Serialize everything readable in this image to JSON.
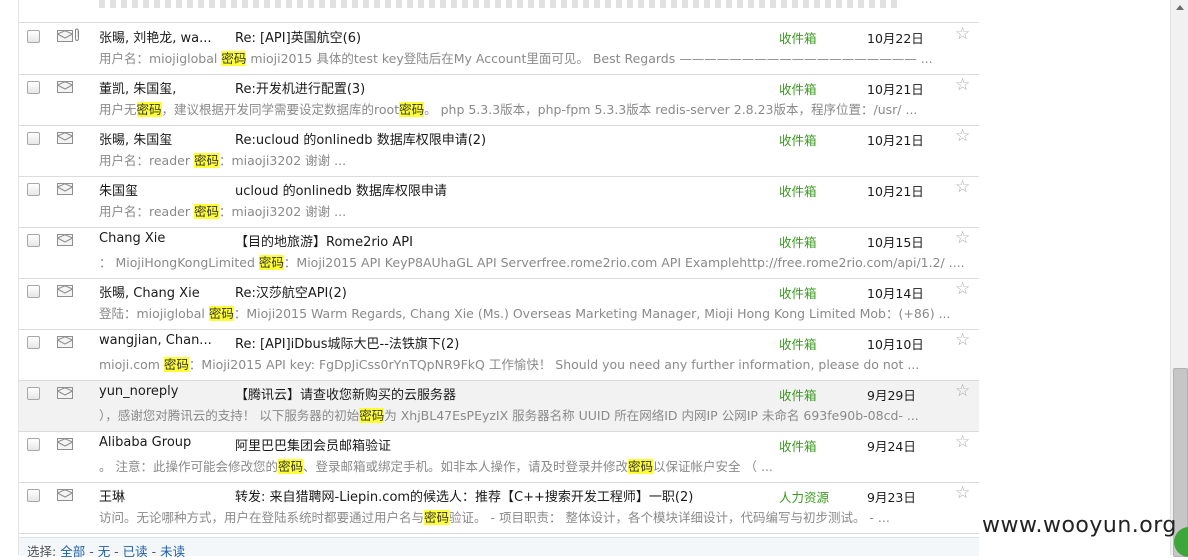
{
  "mail_list": {
    "rows": [
      {
        "from": "张暘, 刘艳龙, wa...",
        "subject": "Re: [API]英国航空(6)",
        "folder": "收件箱",
        "date": "10月22日",
        "attachment": true,
        "snippet": [
          {
            "t": "用户名：miojiglobal "
          },
          {
            "t": "密码",
            "hl": true
          },
          {
            "t": " mioji2015 具体的test key登陆后在My Account里面可见。 Best Regards ——————————————————— ..."
          }
        ]
      },
      {
        "from": "董凯, 朱国玺,",
        "subject": "Re:开发机进行配置(3)",
        "folder": "收件箱",
        "date": "10月21日",
        "attachment": false,
        "snippet": [
          {
            "t": "用户无"
          },
          {
            "t": "密码",
            "hl": true
          },
          {
            "t": "，建议根据开发同学需要设定数据库的root"
          },
          {
            "t": "密码",
            "hl": true
          },
          {
            "t": "。 php 5.3.3版本，php-fpm 5.3.3版本 redis-server 2.8.23版本，程序位置：/usr/ ..."
          }
        ]
      },
      {
        "from": "张暘, 朱国玺",
        "subject": "Re:ucloud 的onlinedb 数据库权限申请(2)",
        "folder": "收件箱",
        "date": "10月21日",
        "attachment": false,
        "snippet": [
          {
            "t": "用户名：reader "
          },
          {
            "t": "密码",
            "hl": true
          },
          {
            "t": "：miaoji3202 谢谢 ..."
          }
        ]
      },
      {
        "from": "朱国玺",
        "subject": "ucloud 的onlinedb 数据库权限申请",
        "folder": "收件箱",
        "date": "10月21日",
        "attachment": false,
        "snippet": [
          {
            "t": "用户名：reader "
          },
          {
            "t": "密码",
            "hl": true
          },
          {
            "t": "：miaoji3202 谢谢 ..."
          }
        ]
      },
      {
        "from": "Chang Xie",
        "subject": "【目的地旅游】Rome2rio API",
        "folder": "收件箱",
        "date": "10月15日",
        "attachment": false,
        "snippet": [
          {
            "t": "： MiojiHongKongLimited "
          },
          {
            "t": "密码",
            "hl": true
          },
          {
            "t": "：Mioji2015 API KeyP8AUhaGL API Serverfree.rome2rio.com API Examplehttp://free.rome2rio.com/api/1.2/ ...."
          }
        ]
      },
      {
        "from": "张暘, Chang Xie",
        "subject": "Re:汉莎航空API(2)",
        "folder": "收件箱",
        "date": "10月14日",
        "attachment": false,
        "snippet": [
          {
            "t": "登陆：miojiglobal "
          },
          {
            "t": "密码",
            "hl": true
          },
          {
            "t": "：Mioji2015 Warm Regards, Chang Xie (Ms.) Overseas Marketing Manager, Mioji Hong Kong Limited Mob：(+86) ..."
          }
        ]
      },
      {
        "from": "wangjian, Chan...",
        "subject": "Re: [API]iDbus城际大巴--法铁旗下(2)",
        "folder": "收件箱",
        "date": "10月10日",
        "attachment": false,
        "snippet": [
          {
            "t": "mioji.com "
          },
          {
            "t": "密码",
            "hl": true
          },
          {
            "t": "：Mioji2015 API key: FgDpJiCss0rYnTQpNR9FkQ 工作愉快！ Should you need any further information, please do not ..."
          }
        ]
      },
      {
        "from": "yun_noreply",
        "subject": "【腾讯云】请查收您新购买的云服务器",
        "folder": "收件箱",
        "date": "9月29日",
        "attachment": false,
        "highlighted": true,
        "snippet": [
          {
            "t": "），感谢您对腾讯云的支持！ 以下服务器的初始"
          },
          {
            "t": "密码",
            "hl": true
          },
          {
            "t": "为 XhjBL47EsPEyzIX 服务器名称 UUID 所在网络ID 内网IP 公网IP 未命名 693fe90b-08cd- ..."
          }
        ]
      },
      {
        "from": "Alibaba Group",
        "subject": "阿里巴巴集团会员邮箱验证",
        "folder": "收件箱",
        "date": "9月24日",
        "attachment": false,
        "snippet": [
          {
            "t": "。 注意：此操作可能会修改您的"
          },
          {
            "t": "密码",
            "hl": true
          },
          {
            "t": "、登录邮箱或绑定手机。如非本人操作，请及时登录并修改"
          },
          {
            "t": "密码",
            "hl": true
          },
          {
            "t": "以保证帐户安全 （ ..."
          }
        ]
      },
      {
        "from": "王琳",
        "subject": "转发: 来自猎聘网-Liepin.com的候选人：推荐【C++搜索开发工程师】一职(2)",
        "folder": "人力资源",
        "date": "9月23日",
        "attachment": false,
        "snippet": [
          {
            "t": "访问。无论哪种方式，用户在登陆系统时都要通过用户名与"
          },
          {
            "t": "密码",
            "hl": true
          },
          {
            "t": "验证。 - 项目职责： 整体设计，各个模块详细设计，代码编写与初步测试。 - ..."
          }
        ]
      }
    ]
  },
  "select_bar": {
    "label": "选择:",
    "all": "全部",
    "none": "无",
    "read": "已读",
    "unread": "未读",
    "sep": " - "
  },
  "watermark": "www.wooyun.org",
  "icons": {
    "checkbox": "checkbox-icon",
    "envelope": "envelope-icon",
    "attachment": "paperclip-icon",
    "star": "star-icon"
  },
  "colors": {
    "folder": "#3a9a1f",
    "keyword_highlight": "#ffff33",
    "snippet": "#8a8a8a",
    "link": "#1d5fa8"
  }
}
